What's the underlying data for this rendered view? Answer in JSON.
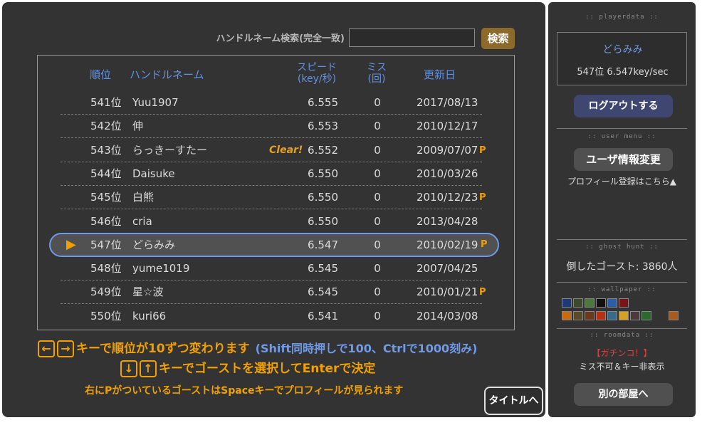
{
  "search": {
    "label": "ハンドルネーム検索(完全一致)",
    "placeholder": "",
    "button_label": "検索"
  },
  "table": {
    "headers": {
      "rank": "順位",
      "name": "ハンドルネーム",
      "speed_line1": "スピード",
      "speed_line2": "(key/秒)",
      "miss_line1": "ミス",
      "miss_line2": "(回)",
      "date": "更新日"
    },
    "rows": [
      {
        "rank": "541位",
        "name": "Yuu1907",
        "clear": "",
        "speed": "6.555",
        "miss": "0",
        "date": "2017/08/13",
        "p": ""
      },
      {
        "rank": "542位",
        "name": "伸",
        "clear": "",
        "speed": "6.553",
        "miss": "0",
        "date": "2010/12/17",
        "p": ""
      },
      {
        "rank": "543位",
        "name": "らっきーすたー",
        "clear": "Clear!",
        "speed": "6.552",
        "miss": "0",
        "date": "2009/07/07",
        "p": "P"
      },
      {
        "rank": "544位",
        "name": "Daisuke",
        "clear": "",
        "speed": "6.550",
        "miss": "0",
        "date": "2010/03/26",
        "p": ""
      },
      {
        "rank": "545位",
        "name": "白熊",
        "clear": "",
        "speed": "6.550",
        "miss": "0",
        "date": "2010/12/23",
        "p": "P"
      },
      {
        "rank": "546位",
        "name": "cria",
        "clear": "",
        "speed": "6.550",
        "miss": "0",
        "date": "2013/04/28",
        "p": ""
      },
      {
        "rank": "547位",
        "name": "どらみみ",
        "clear": "",
        "speed": "6.547",
        "miss": "0",
        "date": "2010/02/19",
        "p": "P"
      },
      {
        "rank": "548位",
        "name": "yume1019",
        "clear": "",
        "speed": "6.545",
        "miss": "0",
        "date": "2007/04/25",
        "p": ""
      },
      {
        "rank": "549位",
        "name": "星☆波",
        "clear": "",
        "speed": "6.545",
        "miss": "0",
        "date": "2010/01/21",
        "p": "P"
      },
      {
        "rank": "550位",
        "name": "kuri66",
        "clear": "",
        "speed": "6.541",
        "miss": "0",
        "date": "2014/03/08",
        "p": ""
      }
    ],
    "selected_index": 6
  },
  "instructions": {
    "line1_keys": [
      "←",
      "→"
    ],
    "line1_text": "キーで順位が10ずつ変わります",
    "line1_sub": "(Shift同時押しで100、Ctrlで1000刻み)",
    "line2_keys": [
      "↓",
      "↑"
    ],
    "line2_text": "キーでゴーストを選択してEnterで決定",
    "line3_text": "右にPがついているゴーストはSpaceキーでプロフィールが見られます"
  },
  "title_button_label": "タイトルへ",
  "sidebar": {
    "playerdata_title": ":: playerdata ::",
    "player_name": "どらみみ",
    "player_stats": "547位  6.547key/sec",
    "logout_label": "ログアウトする",
    "usermenu_title": ":: user menu ::",
    "profile_edit_label": "ユーザ情報変更",
    "profile_link": "プロフィール登録はこちら▲",
    "ghosthunt_title": ":: ghost hunt ::",
    "ghost_count": "倒したゴースト: 3860人",
    "wallpaper_title": ":: wallpaper ::",
    "wallpaper_colors": [
      "#1c3a78",
      "#3a4a2a",
      "#4a7a3a",
      "#111111",
      "#2a5fa8",
      "#7a1515",
      "#c86a10",
      "#5a4a2a",
      "#6a3a1a",
      "#b83010",
      "#3a6a8a",
      "#d8a020",
      "#4a3a3a",
      "#2a6a2a",
      "#aa5a1a"
    ],
    "roomdata_title": ":: roomdata ::",
    "room_name": "【ガチンコ！】",
    "room_desc": "ミス不可＆キー非表示",
    "room_button_label": "別の部屋へ"
  }
}
